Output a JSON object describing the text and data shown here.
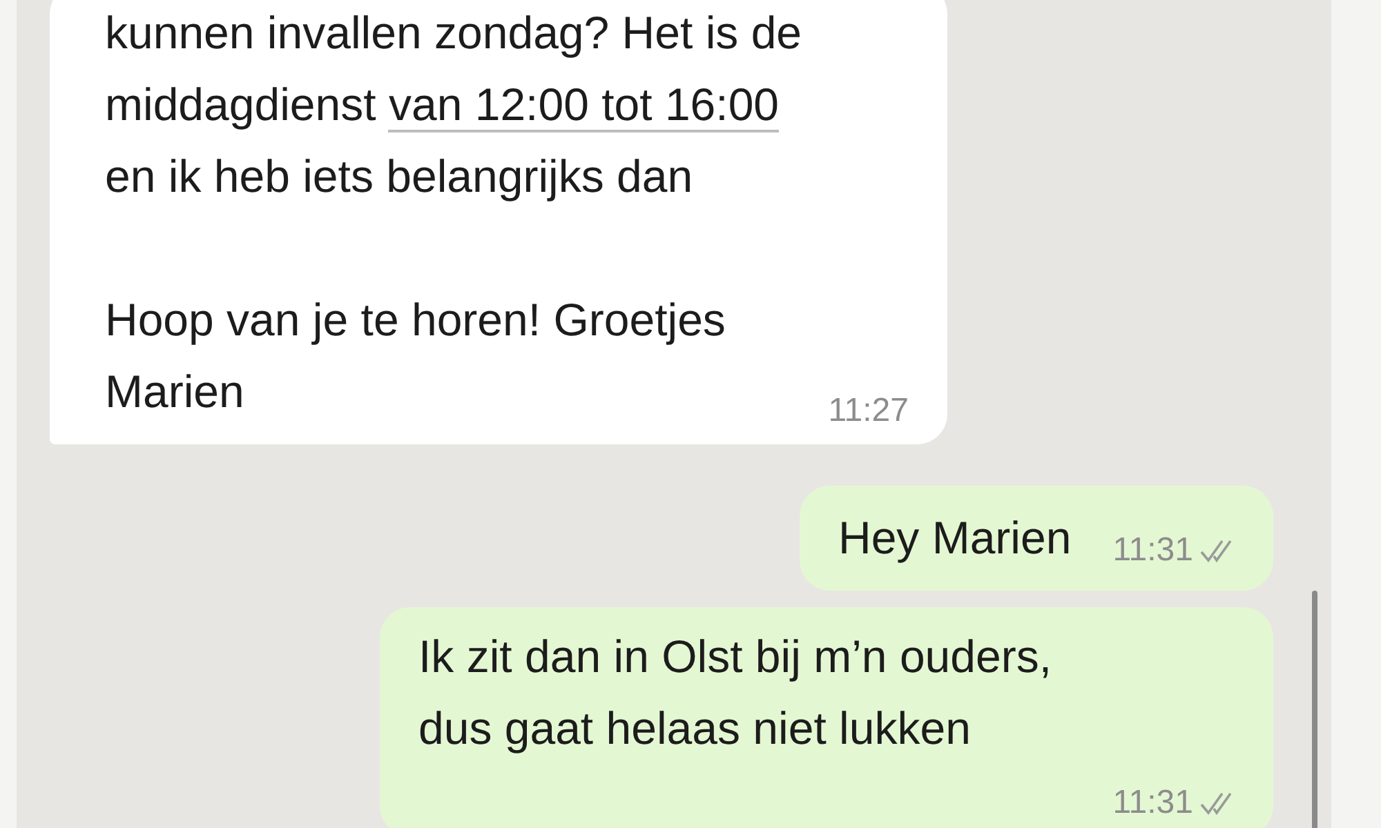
{
  "messages": [
    {
      "kind": "incoming",
      "paragraphs": [
        [
          {
            "text": "kunnen invallen zondag? Het is de\nmiddagdienst "
          },
          {
            "text": "van 12:00 tot 16:00",
            "kind": "link"
          },
          {
            "text": "\nen ik heb iets belangrijks dan"
          }
        ],
        [
          {
            "text": "Hoop van je te horen! Groetjes\nMarien"
          }
        ]
      ],
      "time": "11:27"
    },
    {
      "kind": "outgoing",
      "paragraphs": [
        [
          {
            "text": "Hey Marien"
          }
        ]
      ],
      "time": "11:31",
      "read": false,
      "inline_time": true
    },
    {
      "kind": "outgoing",
      "paragraphs": [
        [
          {
            "text": "Ik zit dan in Olst bij m’n ouders,\ndus gaat helaas niet lukken"
          }
        ]
      ],
      "time": "11:31",
      "read": false,
      "inline_time": false
    }
  ]
}
